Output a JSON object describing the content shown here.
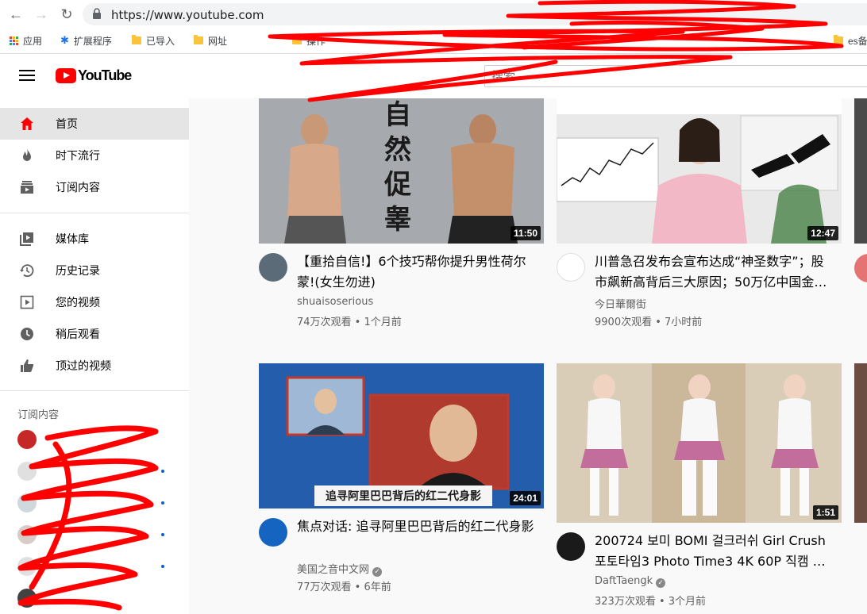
{
  "browser": {
    "url": "https://www.youtube.com",
    "bookmarks": [
      {
        "label": "应用",
        "icon": "apps-grid-icon"
      },
      {
        "label": "扩展程序",
        "icon": "puzzle-icon"
      },
      {
        "label": "已导入",
        "icon": "folder-icon"
      },
      {
        "label": "网址",
        "icon": "folder-icon"
      },
      {
        "label": "操作",
        "icon": "folder-icon"
      },
      {
        "label": "es备",
        "icon": "folder-icon"
      }
    ]
  },
  "header": {
    "logo_text": "YouTube",
    "search_placeholder": "搜索"
  },
  "sidebar": {
    "items": [
      {
        "label": "首页",
        "icon": "home-icon",
        "active": true
      },
      {
        "label": "时下流行",
        "icon": "trending-fire-icon"
      },
      {
        "label": "订阅内容",
        "icon": "subscriptions-icon"
      },
      {
        "label": "媒体库",
        "icon": "library-icon"
      },
      {
        "label": "历史记录",
        "icon": "history-icon"
      },
      {
        "label": "您的视频",
        "icon": "your-videos-icon"
      },
      {
        "label": "稍后观看",
        "icon": "watch-later-icon"
      },
      {
        "label": "顶过的视频",
        "icon": "liked-videos-icon"
      }
    ],
    "subscriptions_heading": "订阅内容"
  },
  "videos": [
    {
      "title": "【重拾自信!】6个技巧帮你提升男性荷尔蒙!(女生勿进)",
      "channel": "shuaisoserious",
      "stats": "74万次观看 • 1个月前",
      "duration": "11:50",
      "verified": false,
      "thumb_text": "自然促睾"
    },
    {
      "title": "川普急召发布会宣布达成“神圣数字”；股市飙新高背后三大原因；50万亿中国金…",
      "channel": "今日華爾街",
      "stats": "9900次观看 • 7小时前",
      "duration": "12:47",
      "verified": false
    },
    {
      "title": "焦点对话: 追寻阿里巴巴背后的红二代身影",
      "channel": "美国之音中文网",
      "stats": "77万次观看 • 6年前",
      "duration": "24:01",
      "verified": true,
      "thumb_caption": "追寻阿里巴巴背后的红二代身影"
    },
    {
      "title": "200724 보미 BOMI 걸크러쉬 Girl Crush 포토타임3 Photo Time3 4K 60P 직캠 …",
      "channel": "DaftTaengk",
      "stats": "323万次观看 • 3个月前",
      "duration": "1:51",
      "verified": true
    }
  ],
  "colors": {
    "brand_red": "#ff0000",
    "scribble_red": "#ff0000",
    "sidebar_active": "#e5e5e5"
  }
}
